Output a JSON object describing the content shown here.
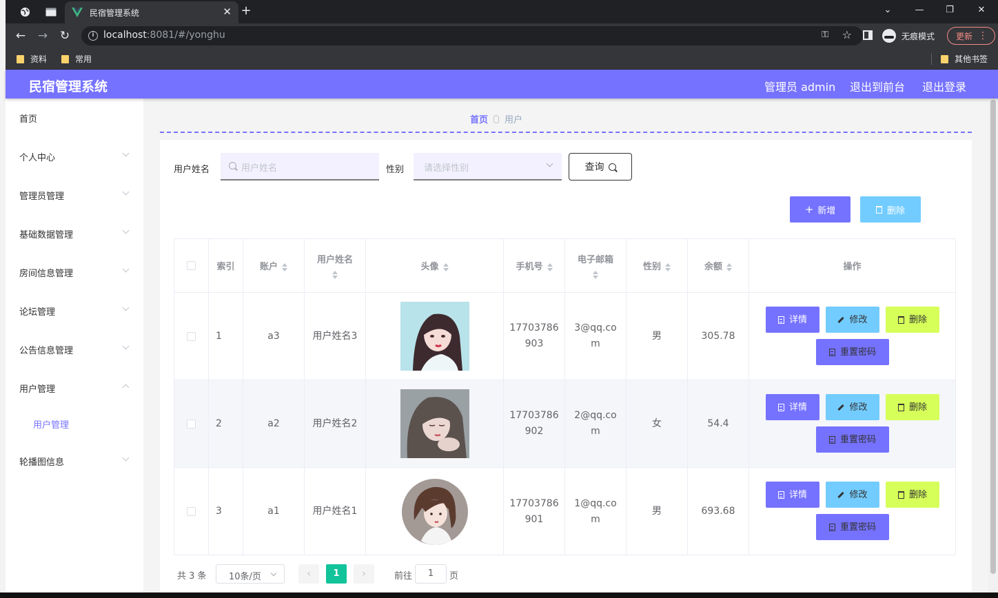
{
  "browser": {
    "tab_title": "民宿管理系统",
    "url_host": "localhost",
    "url_rest": ":8081/#/yonghu",
    "incognito_label": "无痕模式",
    "update_label": "更新",
    "bookmarks": [
      "资料",
      "常用"
    ],
    "other_bookmarks": "其他书签"
  },
  "app": {
    "title": "民宿管理系统",
    "header_links": {
      "admin": "管理员 admin",
      "front": "退出到前台",
      "logout": "退出登录"
    },
    "accent_color": "#7572ff"
  },
  "sidebar": {
    "items": [
      {
        "label": "首页"
      },
      {
        "label": "个人中心"
      },
      {
        "label": "管理员管理"
      },
      {
        "label": "基础数据管理"
      },
      {
        "label": "房间信息管理"
      },
      {
        "label": "论坛管理"
      },
      {
        "label": "公告信息管理"
      },
      {
        "label": "用户管理"
      },
      {
        "label": "用户管理"
      },
      {
        "label": "轮播图信息"
      }
    ]
  },
  "breadcrumb": {
    "home": "首页",
    "current": "用户"
  },
  "search": {
    "name_label": "用户姓名",
    "name_placeholder": "用户姓名",
    "gender_label": "性别",
    "gender_placeholder": "请选择性别",
    "query_label": "查询"
  },
  "actions": {
    "add": "新增",
    "delete": "删除"
  },
  "table": {
    "headers": [
      "索引",
      "账户",
      "用户姓名",
      "头像",
      "手机号",
      "电子邮箱",
      "性别",
      "余额",
      "操作"
    ],
    "rows": [
      {
        "index": "1",
        "account": "a3",
        "name": "用户姓名3",
        "phone_1": "17703786",
        "phone_2": "903",
        "email_1": "3@qq.co",
        "email_2": "m",
        "gender": "男",
        "balance": "305.78"
      },
      {
        "index": "2",
        "account": "a2",
        "name": "用户姓名2",
        "phone_1": "17703786",
        "phone_2": "902",
        "email_1": "2@qq.co",
        "email_2": "m",
        "gender": "女",
        "balance": "54.4"
      },
      {
        "index": "3",
        "account": "a1",
        "name": "用户姓名1",
        "phone_1": "17703786",
        "phone_2": "901",
        "email_1": "1@qq.co",
        "email_2": "m",
        "gender": "男",
        "balance": "693.68"
      }
    ],
    "row_actions": {
      "detail": "详情",
      "edit": "修改",
      "delete": "删除",
      "reset": "重置密码"
    }
  },
  "pager": {
    "total": "共 3 条",
    "page_size": "10条/页",
    "current": "1",
    "goto_label": "前往",
    "goto_value": "1",
    "page_unit": "页"
  }
}
